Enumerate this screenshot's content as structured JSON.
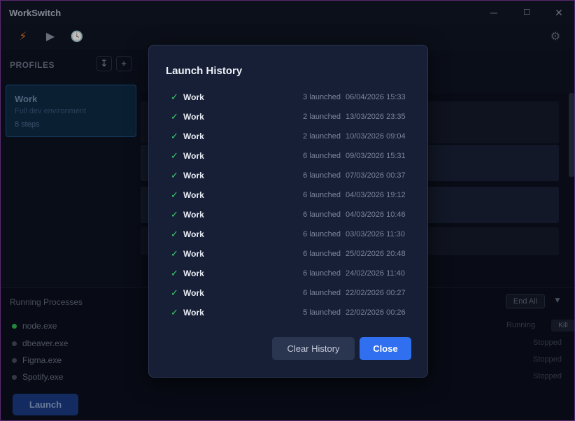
{
  "app": {
    "title": "WorkSwitch"
  },
  "window_controls": {
    "minimize": "─",
    "maximize": "☐",
    "close": "✕"
  },
  "toolbar": {
    "bolt_icon": "⚡",
    "play_icon": "▶",
    "clock_icon": "🕓",
    "gear_icon": "⚙"
  },
  "sidebar": {
    "heading": "PROFILES",
    "import_icon": "↧",
    "add_icon": "+",
    "profiles": [
      {
        "name": "Work",
        "description": "Full dev environment",
        "steps": "8 steps"
      }
    ]
  },
  "running": {
    "title": "Running Processes",
    "end_all": "End All",
    "collapse_icon": "▼",
    "kill_label": "Kill",
    "processes": [
      {
        "name": "node.exe",
        "status": "Running",
        "color": "#2fb34f"
      },
      {
        "name": "dbeaver.exe",
        "status": "Stopped",
        "color": "#454b5a"
      },
      {
        "name": "Figma.exe",
        "status": "Stopped",
        "color": "#454b5a"
      },
      {
        "name": "Spotify.exe",
        "status": "Stopped",
        "color": "#454b5a"
      }
    ]
  },
  "launch_button": "Launch",
  "modal": {
    "title": "Launch History",
    "check_icon": "✓",
    "history": [
      {
        "profile": "Work",
        "count": "3 launched",
        "date": "06/04/2026 15:33"
      },
      {
        "profile": "Work",
        "count": "2 launched",
        "date": "13/03/2026 23:35"
      },
      {
        "profile": "Work",
        "count": "2 launched",
        "date": "10/03/2026 09:04"
      },
      {
        "profile": "Work",
        "count": "6 launched",
        "date": "09/03/2026 15:31"
      },
      {
        "profile": "Work",
        "count": "6 launched",
        "date": "07/03/2026 00:37"
      },
      {
        "profile": "Work",
        "count": "6 launched",
        "date": "04/03/2026 19:12"
      },
      {
        "profile": "Work",
        "count": "6 launched",
        "date": "04/03/2026 10:46"
      },
      {
        "profile": "Work",
        "count": "6 launched",
        "date": "03/03/2026 11:30"
      },
      {
        "profile": "Work",
        "count": "6 launched",
        "date": "25/02/2026 20:48"
      },
      {
        "profile": "Work",
        "count": "6 launched",
        "date": "24/02/2026 11:40"
      },
      {
        "profile": "Work",
        "count": "6 launched",
        "date": "22/02/2026 00:27"
      },
      {
        "profile": "Work",
        "count": "5 launched",
        "date": "22/02/2026 00:26"
      }
    ],
    "clear_button": "Clear History",
    "close_button": "Close"
  }
}
